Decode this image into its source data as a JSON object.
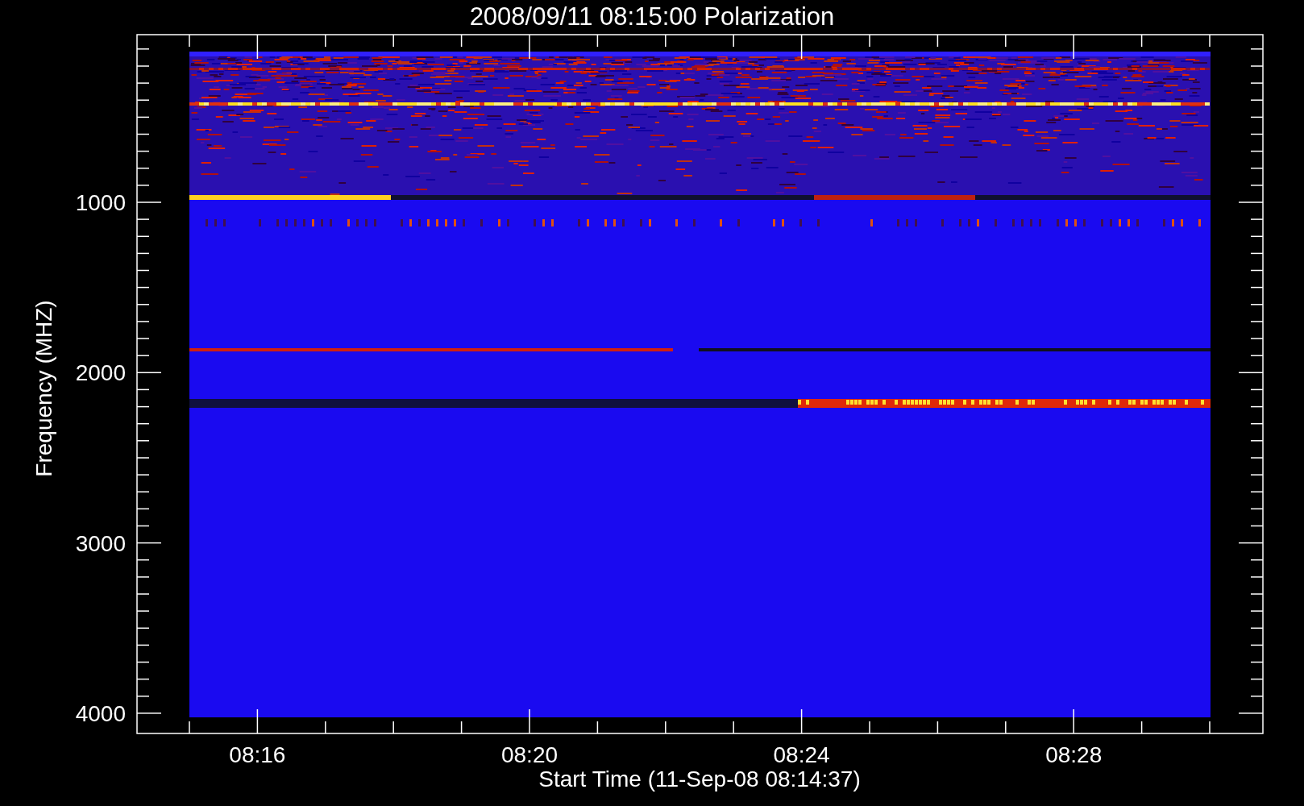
{
  "title": "2008/09/11 08:15:00 Polarization",
  "y_axis": {
    "label": "Frequency (MHZ)",
    "ticks": [
      "1000",
      "2000",
      "3000",
      "4000"
    ]
  },
  "x_axis": {
    "label": "Start Time (11-Sep-08 08:14:37)",
    "ticks": [
      "08:16",
      "08:20",
      "08:24",
      "08:28"
    ]
  }
}
